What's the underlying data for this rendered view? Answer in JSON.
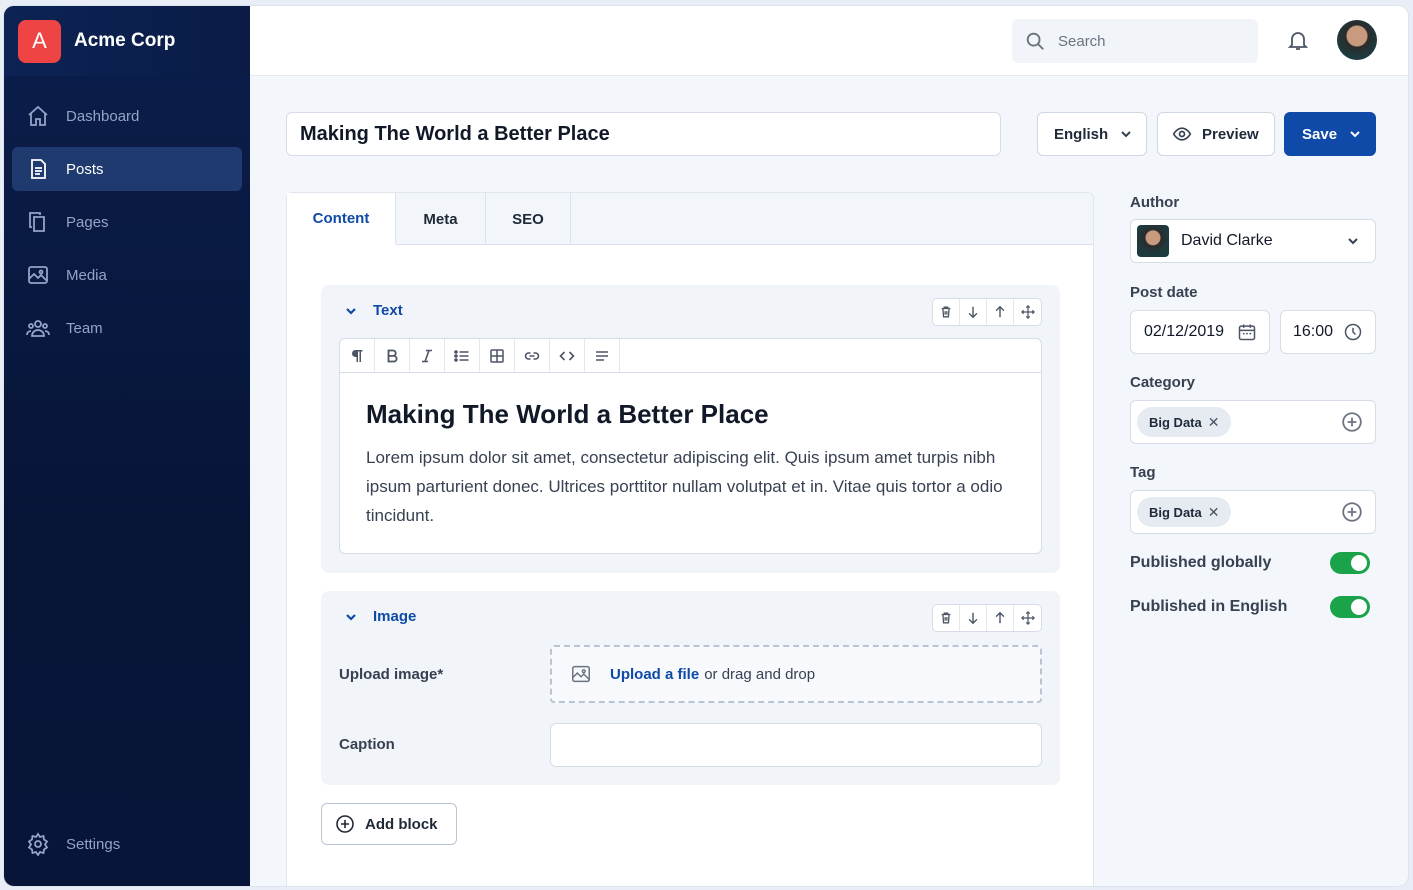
{
  "brand": {
    "logo_letter": "A",
    "name": "Acme Corp",
    "logo_color": "#ef4444"
  },
  "sidebar": {
    "items": [
      {
        "label": "Dashboard",
        "icon": "home-icon",
        "active": false
      },
      {
        "label": "Posts",
        "icon": "document-icon",
        "active": true
      },
      {
        "label": "Pages",
        "icon": "copy-icon",
        "active": false
      },
      {
        "label": "Media",
        "icon": "image-icon",
        "active": false
      },
      {
        "label": "Team",
        "icon": "users-icon",
        "active": false
      }
    ],
    "settings_label": "Settings"
  },
  "header": {
    "search_placeholder": "Search"
  },
  "post": {
    "title": "Making The World a Better Place",
    "language": "English",
    "preview_label": "Preview",
    "save_label": "Save"
  },
  "tabs": [
    {
      "label": "Content",
      "active": true
    },
    {
      "label": "Meta",
      "active": false
    },
    {
      "label": "SEO",
      "active": false
    }
  ],
  "text_block": {
    "title": "Text",
    "heading": "Making The World a Better Place",
    "body": "Lorem ipsum dolor sit amet, consectetur adipiscing elit. Quis ipsum amet turpis nibh ipsum parturient donec. Ultrices porttitor nullam volutpat et in. Vitae quis tortor a odio tincidunt."
  },
  "image_block": {
    "title": "Image",
    "upload_label": "Upload image*",
    "upload_link": "Upload a file",
    "upload_rest": "or drag and drop",
    "caption_label": "Caption",
    "caption_value": ""
  },
  "add_block_label": "Add block",
  "side_panel": {
    "author_label": "Author",
    "author_name": "David Clarke",
    "post_date_label": "Post date",
    "date": "02/12/2019",
    "time": "16:00",
    "category_label": "Category",
    "category_chip": "Big Data",
    "tag_label": "Tag",
    "tag_chip": "Big Data",
    "published_globally_label": "Published globally",
    "published_globally": true,
    "published_english_label": "Published in English",
    "published_english": true
  },
  "colors": {
    "accent": "#0f4aa8",
    "toggle_on": "#1ba34a",
    "sidebar_bg": "#071436"
  }
}
